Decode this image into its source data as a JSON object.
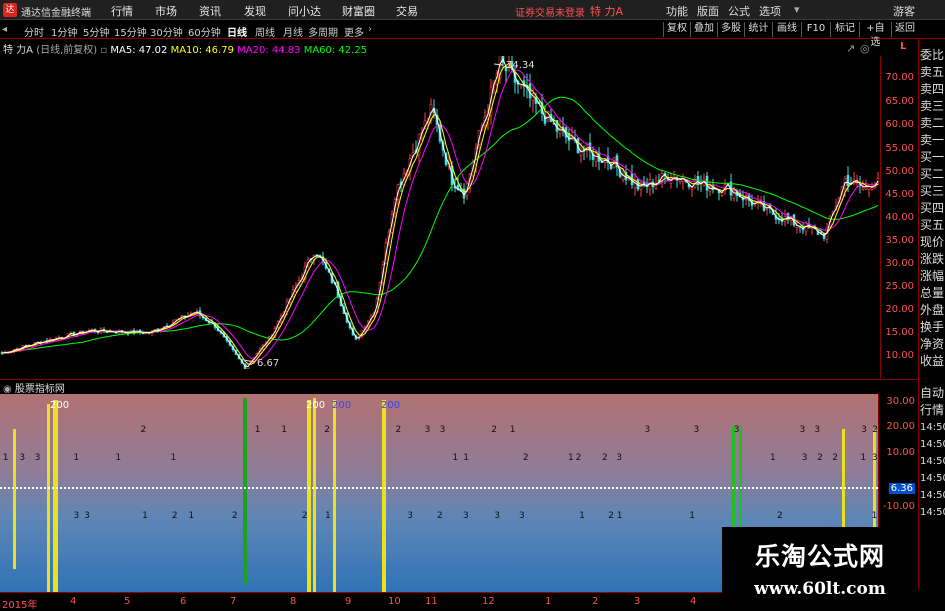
{
  "app": {
    "title": "通达信金融终端",
    "menus": [
      "行情",
      "市场",
      "资讯",
      "发现",
      "问小达",
      "财富圈",
      "交易"
    ],
    "login_warning": "证券交易未登录",
    "stock": "特 力A",
    "right_menus": [
      "功能",
      "版面",
      "公式",
      "选项"
    ],
    "guest": "游客"
  },
  "toolbar": {
    "periods": [
      "分时",
      "1分钟",
      "5分钟",
      "15分钟",
      "30分钟",
      "60分钟",
      "日线",
      "周线",
      "月线",
      "多周期",
      "更多"
    ],
    "selected": "日线",
    "buttons": [
      "复权",
      "叠加",
      "多股",
      "统计",
      "画线",
      "F10",
      "标记",
      "+自选",
      "返回"
    ]
  },
  "info": {
    "name": "特 力A",
    "mode": "(日线,前复权)",
    "ma5": "MA5: 47.02",
    "ma10": "MA10: 46.79",
    "ma20": "MA20: 44.83",
    "ma60": "MA60: 42.25",
    "colors": {
      "ma5": "#ffffff",
      "ma10": "#ffff00",
      "ma20": "#ff00ff",
      "ma60": "#00ff00"
    }
  },
  "price_axis": {
    "corner": "L",
    "ticks": [
      "70.00",
      "65.00",
      "60.00",
      "55.00",
      "50.00",
      "45.00",
      "40.00",
      "35.00",
      "30.00",
      "25.00",
      "20.00",
      "15.00",
      "10.00"
    ]
  },
  "chart_annotations": {
    "high": "74.34",
    "low": "6.67"
  },
  "side_panel": [
    "委比",
    "卖五",
    "卖四",
    "卖三",
    "卖二",
    "卖一",
    "买一",
    "买二",
    "买三",
    "买四",
    "买五",
    "现价",
    "涨跌",
    "涨幅",
    "总量",
    "外盘",
    "换手",
    "净资",
    "收益",
    "自动",
    "行情"
  ],
  "indicator": {
    "header": "股票指标网",
    "axis_ticks": [
      "30.00",
      "20.00",
      "10.00",
      "6.36",
      "-10.00"
    ],
    "time_labels": [
      "14:50",
      "14:50",
      "14:50",
      "14:50",
      "14:50",
      "14:50"
    ],
    "top_labels": [
      "200",
      "200",
      "200",
      "200"
    ]
  },
  "dates": [
    "2015年",
    "4",
    "5",
    "6",
    "7",
    "8",
    "9",
    "10",
    "11",
    "12",
    "1",
    "2",
    "3",
    "4"
  ],
  "watermark": {
    "line1": "乐淘公式网",
    "line2": "www.60lt.com"
  }
}
